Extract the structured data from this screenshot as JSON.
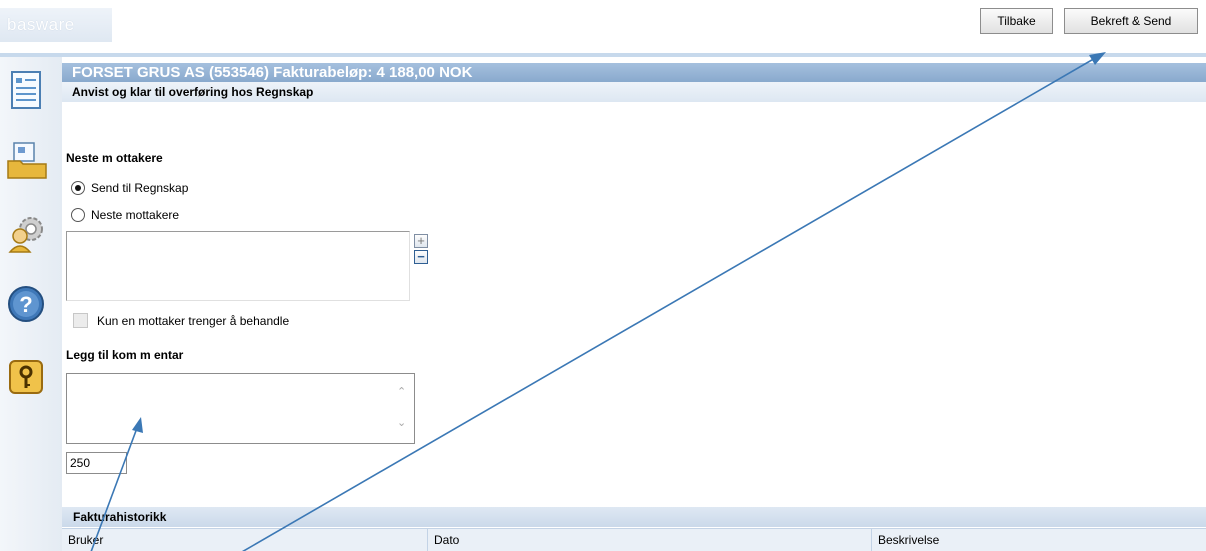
{
  "app": {
    "logo_text": "basware"
  },
  "toolbar": {
    "back_label": "Tilbake",
    "confirm_label": "Bekreft & Send"
  },
  "sidebar": {
    "icons": [
      "document-list-icon",
      "folder-icon",
      "settings-user-icon",
      "help-icon",
      "key-icon"
    ]
  },
  "invoice": {
    "title": "FORSET GRUS AS (553546) Fakturabeløp: 4 188,00 NOK",
    "status": "Anvist og klar til overføring hos Regnskap"
  },
  "recipients": {
    "heading": "Neste m ottakere",
    "option_send": "Send til Regnskap",
    "option_next": "Neste mottakere",
    "selected": "Send til Regnskap",
    "single_label": "Kun en mottaker trenger å behandle"
  },
  "comment": {
    "heading": "Legg til kom m entar",
    "value": "",
    "remaining": "250"
  },
  "history": {
    "title": "Fakturahistorikk",
    "columns": [
      "Bruker",
      "Dato",
      "Beskrivelse"
    ]
  },
  "colors": {
    "header_blue": "#8fb0d4",
    "annotation_arrow": "#3b78b5"
  }
}
